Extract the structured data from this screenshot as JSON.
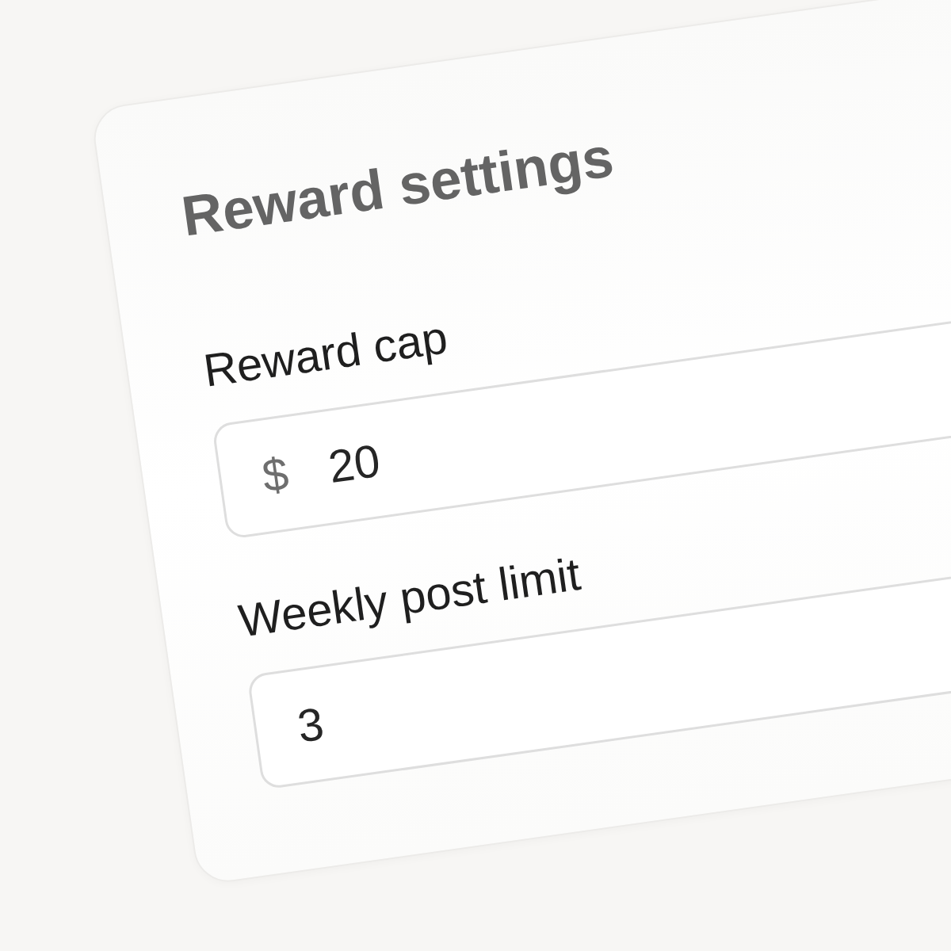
{
  "card": {
    "title": "Reward settings"
  },
  "fields": [
    {
      "label": "Reward cap",
      "prefix": "$",
      "value": "20"
    },
    {
      "label": "Weekly post limit",
      "value": "3"
    }
  ]
}
